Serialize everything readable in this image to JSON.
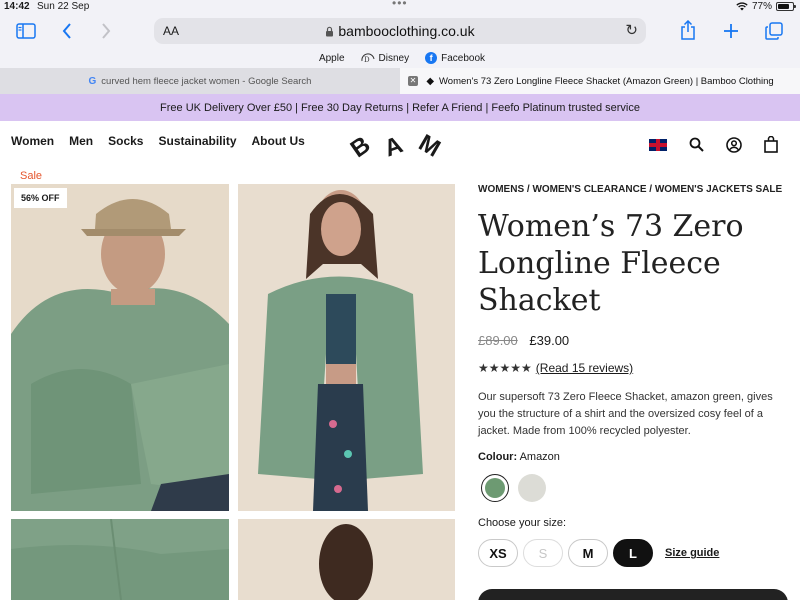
{
  "status": {
    "time": "14:42",
    "date": "Sun 22 Sep",
    "battery": "77%",
    "battery_level": 0.77
  },
  "toolbar": {
    "text_size": "AA",
    "url": "bambooclothing.co.uk"
  },
  "favorites": [
    {
      "label": "Apple",
      "icon": "apple-icon"
    },
    {
      "label": "Disney",
      "icon": "disney-icon"
    },
    {
      "label": "Facebook",
      "icon": "facebook-icon"
    }
  ],
  "tabs": [
    {
      "title": "curved hem fleece jacket women - Google Search",
      "icon": "google-icon",
      "active": false
    },
    {
      "title": "Women's 73 Zero Longline Fleece Shacket (Amazon Green) | Bamboo Clothing",
      "icon": "bam-icon",
      "active": true
    }
  ],
  "promo": "Free UK Delivery Over £50 | Free 30 Day Returns | Refer A Friend | Feefo Platinum trusted service",
  "nav": {
    "links": [
      "Women",
      "Men",
      "Socks",
      "Sustainability",
      "About Us"
    ],
    "logo": [
      "B",
      "A",
      "M"
    ]
  },
  "gallery": {
    "sale_label": "Sale",
    "badge": "56% OFF"
  },
  "product": {
    "breadcrumb": "WOMENS / WOMEN'S CLEARANCE / WOMEN'S JACKETS SALE",
    "title": "Women’s 73 Zero Longline Fleece Shacket",
    "old_price": "£89.00",
    "price": "£39.00",
    "stars": "★★★★★",
    "rating": 5,
    "reviews": "(Read 15 reviews)",
    "description": "Our supersoft 73 Zero Fleece Shacket, amazon green, gives you the structure of a shirt and the oversized cosy feel of a jacket. Made from 100% recycled polyester.",
    "colour_label": "Colour:",
    "colour_value": "Amazon",
    "colours": [
      "#6d9a72",
      "#dcdcd6"
    ],
    "size_label": "Choose your size:",
    "sizes": [
      {
        "label": "XS",
        "state": "available"
      },
      {
        "label": "S",
        "state": "out-of-stock"
      },
      {
        "label": "M",
        "state": "available"
      },
      {
        "label": "L",
        "state": "selected"
      }
    ],
    "size_guide": "Size guide"
  }
}
